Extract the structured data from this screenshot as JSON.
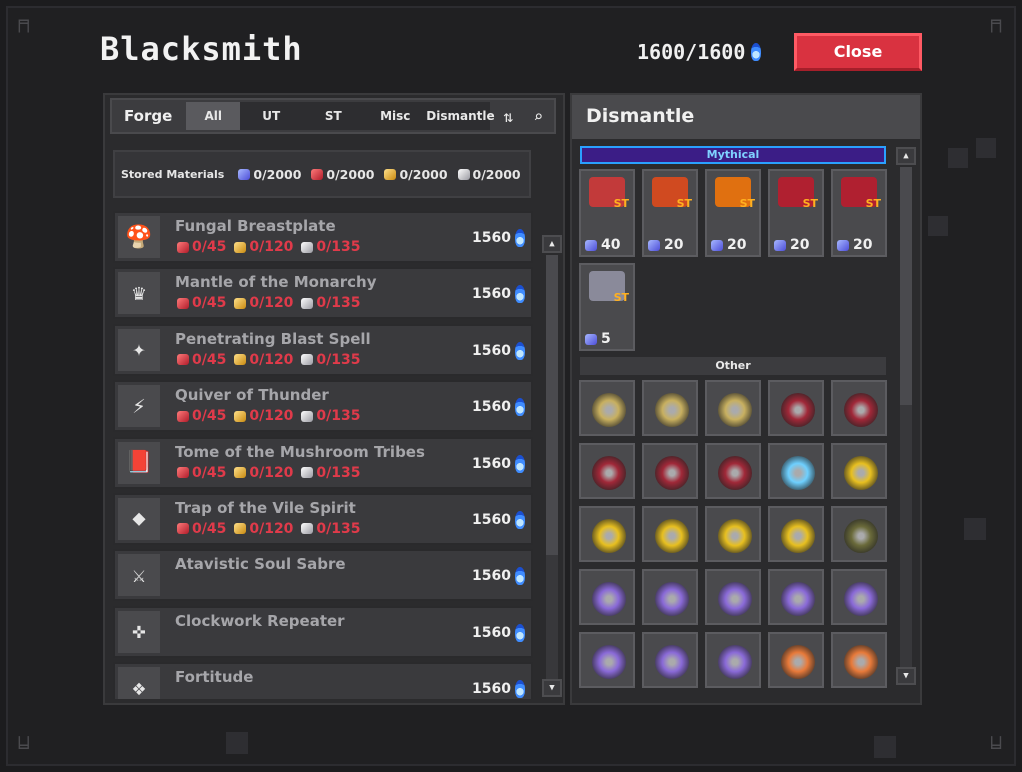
{
  "header": {
    "title": "Blacksmith",
    "currency": "1600/1600",
    "close_label": "Close"
  },
  "forge": {
    "label": "Forge",
    "tabs": [
      "All",
      "UT",
      "ST",
      "Misc",
      "Dismantle"
    ],
    "active_tab": "All"
  },
  "materials": {
    "label": "Stored Materials",
    "values": [
      "0/2000",
      "0/2000",
      "0/2000",
      "0/2000"
    ]
  },
  "items": [
    {
      "name": "Fungal Breastplate",
      "reqs": [
        "0/45",
        "0/120",
        "0/135"
      ],
      "cost": "1560",
      "icon": "mushroom-armor-icon"
    },
    {
      "name": "Mantle of the Monarchy",
      "reqs": [
        "0/45",
        "0/120",
        "0/135"
      ],
      "cost": "1560",
      "icon": "monarch-mantle-icon"
    },
    {
      "name": "Penetrating Blast Spell",
      "reqs": [
        "0/45",
        "0/120",
        "0/135"
      ],
      "cost": "1560",
      "icon": "spell-icon"
    },
    {
      "name": "Quiver of Thunder",
      "reqs": [
        "0/45",
        "0/120",
        "0/135"
      ],
      "cost": "1560",
      "icon": "quiver-icon"
    },
    {
      "name": "Tome of the Mushroom Tribes",
      "reqs": [
        "0/45",
        "0/120",
        "0/135"
      ],
      "cost": "1560",
      "icon": "tome-icon"
    },
    {
      "name": "Trap of the Vile Spirit",
      "reqs": [
        "0/45",
        "0/120",
        "0/135"
      ],
      "cost": "1560",
      "icon": "trap-icon"
    },
    {
      "name": "Atavistic Soul Sabre",
      "reqs": [],
      "cost": "1560",
      "icon": "sabre-icon"
    },
    {
      "name": "Clockwork Repeater",
      "reqs": [],
      "cost": "1560",
      "icon": "repeater-icon"
    },
    {
      "name": "Fortitude",
      "reqs": [],
      "cost": "1560",
      "icon": "fortitude-icon"
    }
  ],
  "dismantle": {
    "title": "Dismantle",
    "mythical_label": "Mythical",
    "other_label": "Other",
    "mythical_slots": [
      {
        "qty": "40",
        "tag": "ST",
        "icon": "potion-icon"
      },
      {
        "qty": "20",
        "tag": "ST",
        "icon": "wand-icon"
      },
      {
        "qty": "20",
        "tag": "ST",
        "icon": "bow-icon"
      },
      {
        "qty": "20",
        "tag": "ST",
        "icon": "armor-icon"
      },
      {
        "qty": "20",
        "tag": "ST",
        "icon": "armor-icon"
      },
      {
        "qty": "5",
        "tag": "ST",
        "icon": "axe-icon"
      }
    ],
    "other_slot_colors": [
      "#c8b060",
      "#c8b060",
      "#c8b060",
      "#a02838",
      "#a02838",
      "#a02838",
      "#a02838",
      "#a02838",
      "#6ed0ff",
      "#e8c020",
      "#e8c020",
      "#e8c020",
      "#e8c020",
      "#e8c020",
      "#6a6a3a",
      "#8a6ad8",
      "#8a6ad8",
      "#8a6ad8",
      "#8a6ad8",
      "#8a6ad8",
      "#8a6ad8",
      "#8a6ad8",
      "#8a6ad8",
      "#e87a3a",
      "#e87a3a"
    ]
  },
  "colors": {
    "close": "#d93240",
    "req_text": "#e03a4a",
    "mythical": "#3b1d86"
  }
}
